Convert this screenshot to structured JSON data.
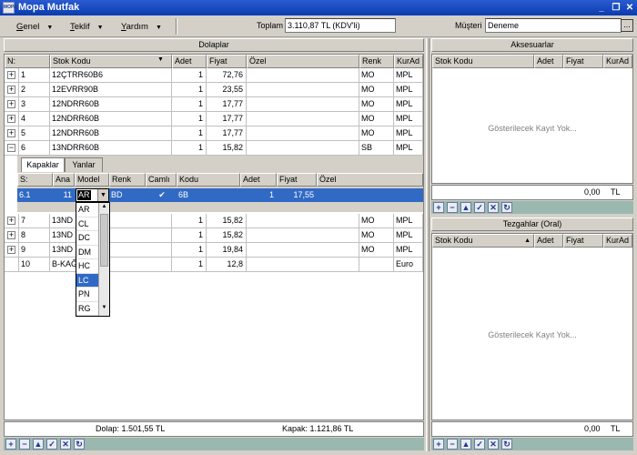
{
  "app": {
    "title": "Mopa Mutfak",
    "icon": "app-logo",
    "icon_text": "MOPA"
  },
  "menu": [
    {
      "label": "Genel",
      "key": "G",
      "rest": "enel"
    },
    {
      "label": "Teklif",
      "key": "T",
      "rest": "eklif"
    },
    {
      "label": "Yardım",
      "key": "Y",
      "rest": "ardım"
    }
  ],
  "toolbar": {
    "toplam_label": "Toplam",
    "toplam_value": "3.110,87 TL (KDV'li)",
    "musteri_label": "Müşteri",
    "musteri_value": "Deneme",
    "ellipsis": "..."
  },
  "dolaplar": {
    "title": "Dolaplar",
    "columns": [
      "N:",
      "Stok Kodu",
      "Adet",
      "Fiyat",
      "Özel",
      "Renk",
      "KurAd"
    ],
    "rows": [
      {
        "n": "1",
        "stok": "12ÇTRR60B6",
        "adet": "1",
        "fiyat": "72,76",
        "ozel": "",
        "renk": "MO",
        "kur": "MPL",
        "exp": "+"
      },
      {
        "n": "2",
        "stok": "12EVRR90B",
        "adet": "1",
        "fiyat": "23,55",
        "ozel": "",
        "renk": "MO",
        "kur": "MPL",
        "exp": "+"
      },
      {
        "n": "3",
        "stok": "12NDRR60B",
        "adet": "1",
        "fiyat": "17,77",
        "ozel": "",
        "renk": "MO",
        "kur": "MPL",
        "exp": "+"
      },
      {
        "n": "4",
        "stok": "12NDRR60B",
        "adet": "1",
        "fiyat": "17,77",
        "ozel": "",
        "renk": "MO",
        "kur": "MPL",
        "exp": "+"
      },
      {
        "n": "5",
        "stok": "12NDRR60B",
        "adet": "1",
        "fiyat": "17,77",
        "ozel": "",
        "renk": "MO",
        "kur": "MPL",
        "exp": "+"
      },
      {
        "n": "6",
        "stok": "13NDRR60B",
        "adet": "1",
        "fiyat": "15,82",
        "ozel": "",
        "renk": "SB",
        "kur": "MPL",
        "exp": "−"
      }
    ],
    "rows2": [
      {
        "n": "7",
        "stok": "13ND",
        "adet": "1",
        "fiyat": "15,82",
        "ozel": "",
        "renk": "MO",
        "kur": "MPL",
        "exp": "+"
      },
      {
        "n": "8",
        "stok": "13ND",
        "adet": "1",
        "fiyat": "15,82",
        "ozel": "",
        "renk": "MO",
        "kur": "MPL",
        "exp": "+"
      },
      {
        "n": "9",
        "stok": "13ND",
        "adet": "1",
        "fiyat": "19,84",
        "ozel": "",
        "renk": "MO",
        "kur": "MPL",
        "exp": "+"
      },
      {
        "n": "10",
        "stok": "B-KAĞ",
        "adet": "1",
        "fiyat": "12,8",
        "ozel": "",
        "renk": "",
        "kur": "Euro",
        "exp": ""
      }
    ],
    "footer_dolap": "Dolap: 1.501,55 TL",
    "footer_kapak": "Kapak: 1.121,86 TL"
  },
  "kapaklar": {
    "tabs": [
      "Kapaklar",
      "Yanlar"
    ],
    "columns": [
      "S:",
      "Ana",
      "Model",
      "Renk",
      "Camlı",
      "Kodu",
      "Adet",
      "Fiyat",
      "Özel"
    ],
    "row": {
      "s": "6.1",
      "ana": "11",
      "model": "AR",
      "renk": "BD",
      "camli": "✔",
      "kodu": "6B",
      "adet": "1",
      "fiyat": "17,55",
      "ozel": ""
    },
    "model_options": [
      "AR",
      "CL",
      "DC",
      "DM",
      "HC",
      "LC",
      "PN",
      "RG"
    ],
    "model_selected": "LC"
  },
  "aksesuarlar": {
    "title": "Aksesuarlar",
    "columns": [
      "Stok Kodu",
      "Adet",
      "Fiyat",
      "KurAd"
    ],
    "empty": "Gösterilecek Kayıt Yok...",
    "total": "0,00",
    "currency": "TL"
  },
  "tezgahlar": {
    "title": "Tezgahlar (Oral)",
    "columns": [
      "Stok Kodu",
      "Adet",
      "Fiyat",
      "KurAd"
    ],
    "empty": "Gösterilecek Kayıt Yok...",
    "total": "0,00",
    "currency": "TL"
  },
  "nav": [
    "+",
    "−",
    "▲",
    "✓",
    "✕",
    "↻"
  ],
  "colors": {
    "selection": "#316ac5",
    "titlebar": "#0a3cb0",
    "navbar": "#9ab8b0"
  }
}
